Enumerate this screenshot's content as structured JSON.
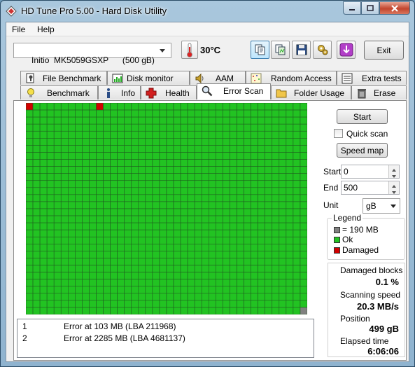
{
  "window": {
    "title": "HD Tune Pro 5.00 - Hard Disk Utility"
  },
  "menu": {
    "file": "File",
    "help": "Help"
  },
  "toolbar": {
    "drive": "Initio  MK5059GSXP      (500 gB)",
    "temperature": "30°C",
    "exit_label": "Exit"
  },
  "tabs": {
    "row1": [
      {
        "label": "File Benchmark",
        "icon": "file-benchmark-icon"
      },
      {
        "label": "Disk monitor",
        "icon": "disk-monitor-icon"
      },
      {
        "label": "AAM",
        "icon": "speaker-icon"
      },
      {
        "label": "Random Access",
        "icon": "random-access-icon"
      },
      {
        "label": "Extra tests",
        "icon": "extra-tests-icon"
      }
    ],
    "row2": [
      {
        "label": "Benchmark",
        "icon": "lightbulb-icon"
      },
      {
        "label": "Info",
        "icon": "info-icon"
      },
      {
        "label": "Health",
        "icon": "health-cross-icon"
      },
      {
        "label": "Error Scan",
        "icon": "magnifier-icon"
      },
      {
        "label": "Folder Usage",
        "icon": "folder-icon"
      },
      {
        "label": "Erase",
        "icon": "trash-icon"
      }
    ],
    "active": "Error Scan"
  },
  "scan": {
    "start_label": "Start",
    "quick_scan_label": "Quick scan",
    "speed_map_label": "Speed map",
    "start_field_label": "Start",
    "start_value": "0",
    "end_field_label": "End",
    "end_value": "500",
    "unit_label": "Unit",
    "unit_value": "gB",
    "grid": {
      "columns": 40,
      "rows": 30,
      "damaged": [
        [
          0,
          0
        ],
        [
          0,
          10
        ]
      ],
      "last_block": [
        29,
        39
      ]
    }
  },
  "legend": {
    "title": "Legend",
    "items": [
      {
        "label": "= 190 MB",
        "color": "#808080"
      },
      {
        "label": "Ok",
        "color": "#22c322"
      },
      {
        "label": "Damaged",
        "color": "#d20000"
      }
    ]
  },
  "stats": {
    "damaged_label": "Damaged blocks",
    "damaged_value": "0.1 %",
    "speed_label": "Scanning speed",
    "speed_value": "20.3 MB/s",
    "position_label": "Position",
    "position_value": "499 gB",
    "elapsed_label": "Elapsed time",
    "elapsed_value": "6:06:06"
  },
  "errors": [
    {
      "num": "1",
      "text": "Error at 103 MB (LBA 211968)"
    },
    {
      "num": "2",
      "text": "Error at 2285 MB (LBA 4681137)"
    }
  ],
  "colors": {
    "ok": "#22c322",
    "damaged": "#d20000",
    "grid_line": "#1f5f1f",
    "accent": "#3c7fb1"
  }
}
